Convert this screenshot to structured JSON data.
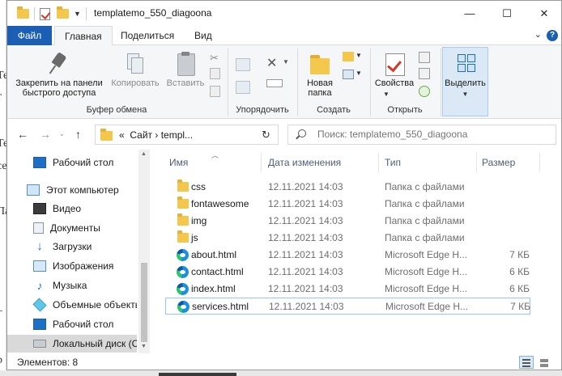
{
  "window": {
    "title": "templatemo_550_diagoona",
    "controls": {
      "minimize": "—",
      "maximize": "☐",
      "close": "✕"
    }
  },
  "ribbon_tabs": {
    "file": "Файл",
    "items": [
      "Главная",
      "Поделиться",
      "Вид"
    ],
    "active": "Главная"
  },
  "ribbon": {
    "pin": "Закрепить на панели быстрого доступа",
    "copy": "Копировать",
    "paste": "Вставить",
    "new_folder": "Новая папка",
    "properties": "Свойства",
    "select": "Выделить",
    "groups": {
      "clipboard": "Буфер обмена",
      "organize": "Упорядочить",
      "create": "Создать",
      "open": "Открыть"
    }
  },
  "address": {
    "path": "Сайт  ›  templ...",
    "prefix": "«",
    "search_placeholder": "Поиск: templatemo_550_diagoona"
  },
  "nav_pane": {
    "items": [
      {
        "label": "Рабочий стол",
        "icon": "desktop-icon"
      },
      {
        "label": "Этот компьютер",
        "icon": "computer-icon"
      },
      {
        "label": "Видео",
        "icon": "video-icon"
      },
      {
        "label": "Документы",
        "icon": "documents-icon"
      },
      {
        "label": "Загрузки",
        "icon": "downloads-icon"
      },
      {
        "label": "Изображения",
        "icon": "pictures-icon"
      },
      {
        "label": "Музыка",
        "icon": "music-icon"
      },
      {
        "label": "Объемные объекты",
        "icon": "3d-objects-icon"
      },
      {
        "label": "Рабочий стол",
        "icon": "desktop-icon"
      },
      {
        "label": "Локальный диск (C:",
        "icon": "drive-icon"
      }
    ],
    "selected_index": 9
  },
  "columns": {
    "name": "Имя",
    "date": "Дата изменения",
    "type": "Тип",
    "size": "Размер"
  },
  "files": [
    {
      "name": "css",
      "date": "12.11.2021 14:03",
      "type": "Папка с файлами",
      "size": "",
      "kind": "folder"
    },
    {
      "name": "fontawesome",
      "date": "12.11.2021 14:03",
      "type": "Папка с файлами",
      "size": "",
      "kind": "folder"
    },
    {
      "name": "img",
      "date": "12.11.2021 14:03",
      "type": "Папка с файлами",
      "size": "",
      "kind": "folder"
    },
    {
      "name": "js",
      "date": "12.11.2021 14:03",
      "type": "Папка с файлами",
      "size": "",
      "kind": "folder"
    },
    {
      "name": "about.html",
      "date": "12.11.2021 14:03",
      "type": "Microsoft Edge H...",
      "size": "7 КБ",
      "kind": "edge"
    },
    {
      "name": "contact.html",
      "date": "12.11.2021 14:03",
      "type": "Microsoft Edge H...",
      "size": "6 КБ",
      "kind": "edge"
    },
    {
      "name": "index.html",
      "date": "12.11.2021 14:03",
      "type": "Microsoft Edge H...",
      "size": "6 КБ",
      "kind": "edge"
    },
    {
      "name": "services.html",
      "date": "12.11.2021 14:03",
      "type": "Microsoft Edge H...",
      "size": "7 КБ",
      "kind": "edge"
    }
  ],
  "status": {
    "count": "Элементов: 8"
  }
}
